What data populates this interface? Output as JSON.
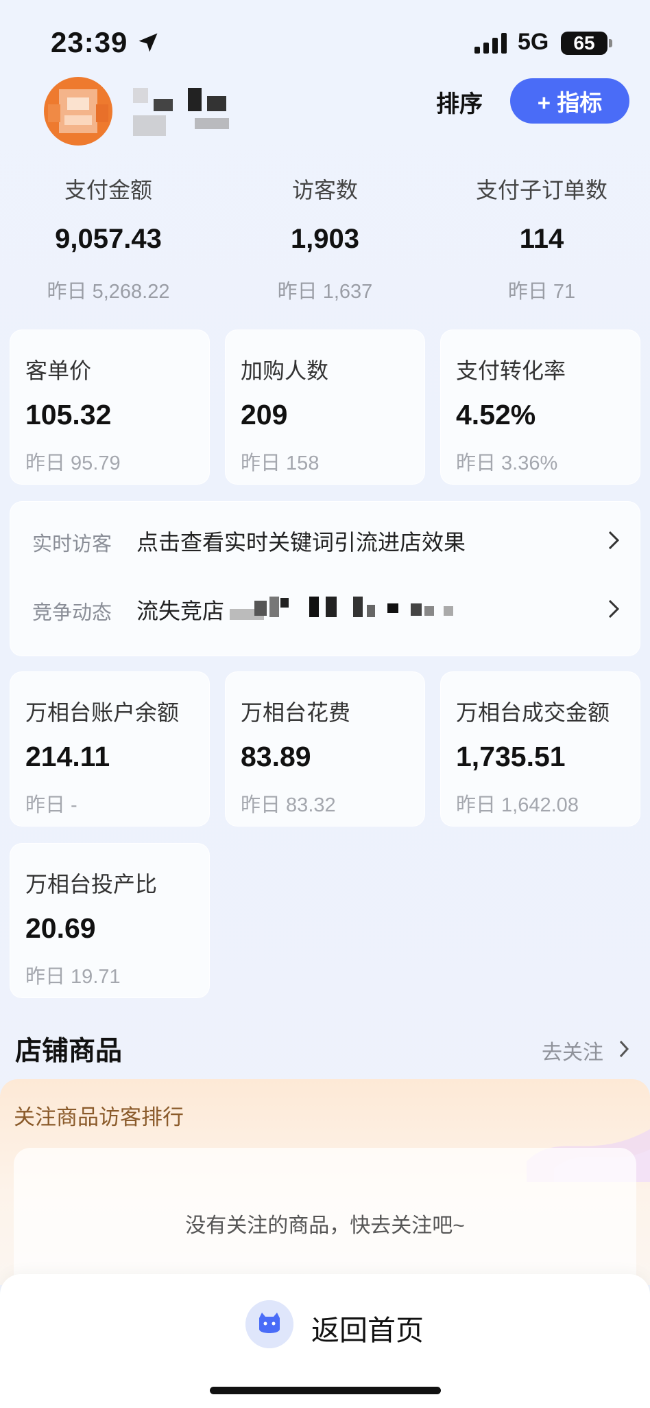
{
  "status_bar": {
    "time": "23:39",
    "network": "5G",
    "battery": "65"
  },
  "header": {
    "sort_label": "排序",
    "add_metric_label": "+ 指标"
  },
  "top_metrics": [
    {
      "label": "支付金额",
      "value": "9,057.43",
      "prev": "昨日 5,268.22"
    },
    {
      "label": "访客数",
      "value": "1,903",
      "prev": "昨日 1,637"
    },
    {
      "label": "支付子订单数",
      "value": "114",
      "prev": "昨日 71"
    }
  ],
  "metric_cards_row1": [
    {
      "label": "客单价",
      "value": "105.32",
      "prev": "昨日 95.79"
    },
    {
      "label": "加购人数",
      "value": "209",
      "prev": "昨日 158"
    },
    {
      "label": "支付转化率",
      "value": "4.52%",
      "prev": "昨日 3.36%"
    }
  ],
  "info": {
    "realtime_tag": "实时访客",
    "realtime_text": "点击查看实时关键词引流进店效果",
    "competition_tag": "竞争动态",
    "competition_text": "流失竞店"
  },
  "metric_cards_row2": [
    {
      "label": "万相台账户余额",
      "value": "214.11",
      "prev": "昨日 -"
    },
    {
      "label": "万相台花费",
      "value": "83.89",
      "prev": "昨日 83.32"
    },
    {
      "label": "万相台成交金额",
      "value": "1,735.51",
      "prev": "昨日 1,642.08"
    }
  ],
  "metric_cards_row3": [
    {
      "label": "万相台投产比",
      "value": "20.69",
      "prev": "昨日 19.71"
    }
  ],
  "shop_products": {
    "title": "店铺商品",
    "follow_link": "去关注",
    "panel_title": "关注商品访客排行",
    "empty_text": "没有关注的商品，快去关注吧~"
  },
  "bottom": {
    "home_label": "返回首页"
  },
  "colors": {
    "accent": "#4a6cf7",
    "avatar": "#ee7a2e"
  }
}
